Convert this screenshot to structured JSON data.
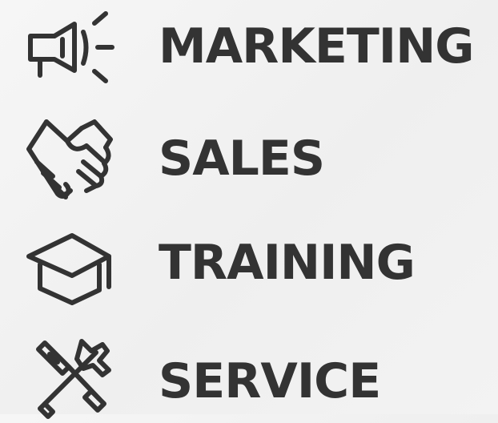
{
  "colors": {
    "text": "#333333",
    "icon": "#333333",
    "background": "#f2f2f2"
  },
  "items": [
    {
      "label": "MARKETING",
      "icon": "megaphone-icon"
    },
    {
      "label": "SALES",
      "icon": "handshake-icon"
    },
    {
      "label": "TRAINING",
      "icon": "graduation-cap-icon"
    },
    {
      "label": "SERVICE",
      "icon": "tools-icon"
    }
  ]
}
